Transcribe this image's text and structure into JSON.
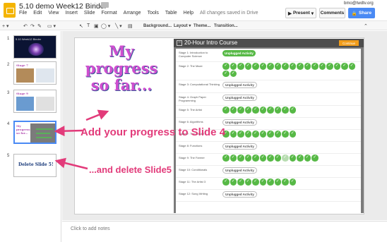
{
  "app": {
    "title": "5.10 demo Week12 Binder",
    "user": "bmo@twdtv.org"
  },
  "menu": [
    "File",
    "Edit",
    "View",
    "Insert",
    "Slide",
    "Format",
    "Arrange",
    "Tools",
    "Table",
    "Help"
  ],
  "saved_status": "All changes saved in Drive",
  "header_buttons": {
    "present": "Present",
    "comments": "Comments",
    "share": "Share"
  },
  "toolbar": {
    "background": "Background...",
    "layout": "Layout",
    "theme": "Theme...",
    "transition": "Transition...",
    "collapse": "⌃"
  },
  "filmstrip": {
    "numbers": [
      "1",
      "2",
      "3",
      "4",
      "5"
    ],
    "thumb1_text": "5.10 Week12 Binder",
    "thumb2_text": "Stage 7",
    "thumb3_text": "Stage 9",
    "thumb4_text": "My progress so far...",
    "thumb5_text": "Delete Slide 5!"
  },
  "slide": {
    "heading": "My progress so far...",
    "add_note": "Add your progress to Slide 4",
    "delete_note": "...and delete Slide5",
    "course": {
      "title": "20-Hour Intro Course",
      "button": "Continue"
    }
  },
  "course_rows": [
    {
      "label": "Stage 1: Introduction to Computer Science",
      "status": "Unplugged Activity",
      "done": true,
      "checks": 0
    },
    {
      "label": "Stage 2: The Maze",
      "status": "",
      "done": false,
      "checks": 20
    },
    {
      "label": "Stage 3: Computational Thinking",
      "status": "Unplugged Activity",
      "done": false,
      "checks": 0
    },
    {
      "label": "Stage 4: Graph Paper Programming",
      "status": "Unplugged Activity",
      "done": false,
      "checks": 0
    },
    {
      "label": "Stage 5: The Artist",
      "status": "",
      "done": false,
      "checks": 10
    },
    {
      "label": "Stage 6: Algorithms",
      "status": "Unplugged Activity",
      "done": false,
      "checks": 0
    },
    {
      "label": "Stage 7: The Artist 2",
      "status": "",
      "done": false,
      "checks": 10
    },
    {
      "label": "Stage 8: Functions",
      "status": "Unplugged Activity",
      "done": false,
      "checks": 0
    },
    {
      "label": "Stage 9: The Farmer",
      "status": "",
      "done": false,
      "checks": 13
    },
    {
      "label": "Stage 10: Conditionals",
      "status": "Unplugged Activity",
      "done": false,
      "checks": 0
    },
    {
      "label": "Stage 11: The Artist 3",
      "status": "",
      "done": false,
      "checks": 10
    },
    {
      "label": "Stage 12: Song Writing",
      "status": "Unplugged Activity",
      "done": false,
      "checks": 0
    }
  ],
  "notes_placeholder": "Click to add notes",
  "colors": {
    "accent": "#4a8af4",
    "progress_text": "#d04fd0",
    "annotation": "#e23b7a",
    "check": "#57b946"
  }
}
